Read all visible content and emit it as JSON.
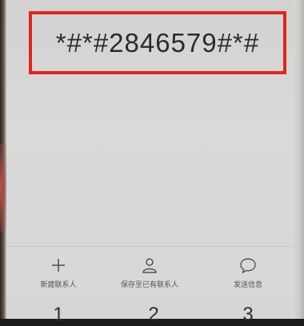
{
  "dialer": {
    "number": "*#*#2846579#*#"
  },
  "actions": {
    "new_contact": "新建联系人",
    "save_to_existing": "保存至已有联系人",
    "send_message": "发送信息"
  },
  "keypad": {
    "keys": [
      "1",
      "2",
      "3"
    ]
  },
  "colors": {
    "highlight": "#e3231c",
    "screen": "#d6d6d6"
  }
}
